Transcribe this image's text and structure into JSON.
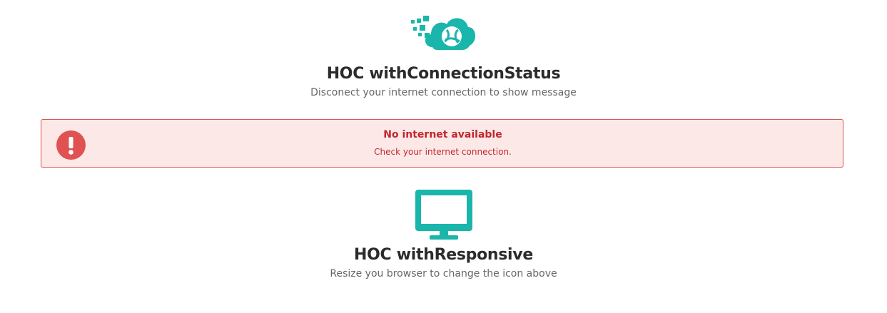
{
  "connection_section": {
    "icon": "cloud-data-icon",
    "title": "HOC withConnectionStatus",
    "subtitle": "Disconect your internet connection to show message"
  },
  "alert": {
    "icon": "exclamation-circle-icon",
    "title": "No internet available",
    "message": "Check your internet connection."
  },
  "responsive_section": {
    "icon": "desktop-monitor-icon",
    "title": "HOC withResponsive",
    "subtitle": "Resize you browser to change the icon above"
  },
  "colors": {
    "teal": "#1ab5ab",
    "alert_bg": "#fde8e8",
    "alert_border": "#d9534f",
    "alert_text": "#c0272d",
    "alert_icon": "#e05252"
  }
}
